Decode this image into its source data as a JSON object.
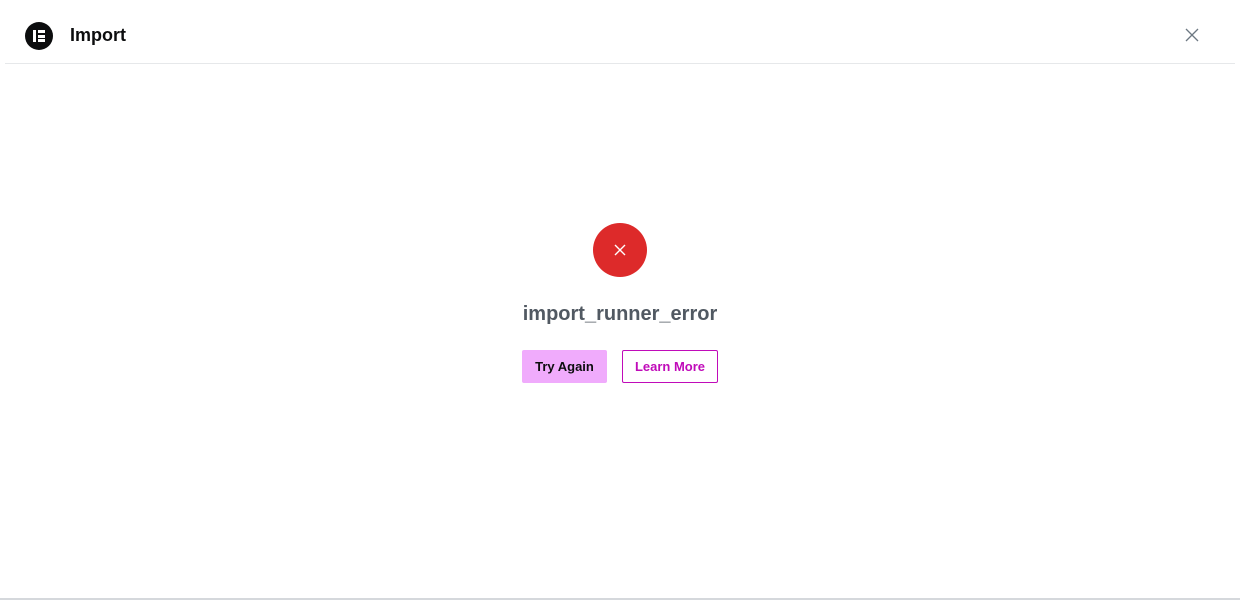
{
  "header": {
    "title": "Import",
    "logo_icon": "elementor-logo-icon",
    "close_icon": "close-icon"
  },
  "error": {
    "icon": "error-x-icon",
    "message": "import_runner_error",
    "accent_color": "#dd2a2a"
  },
  "actions": {
    "try_again_label": "Try Again",
    "learn_more_label": "Learn More",
    "primary_color": "#f0abfc",
    "secondary_color": "#c00bb9"
  }
}
